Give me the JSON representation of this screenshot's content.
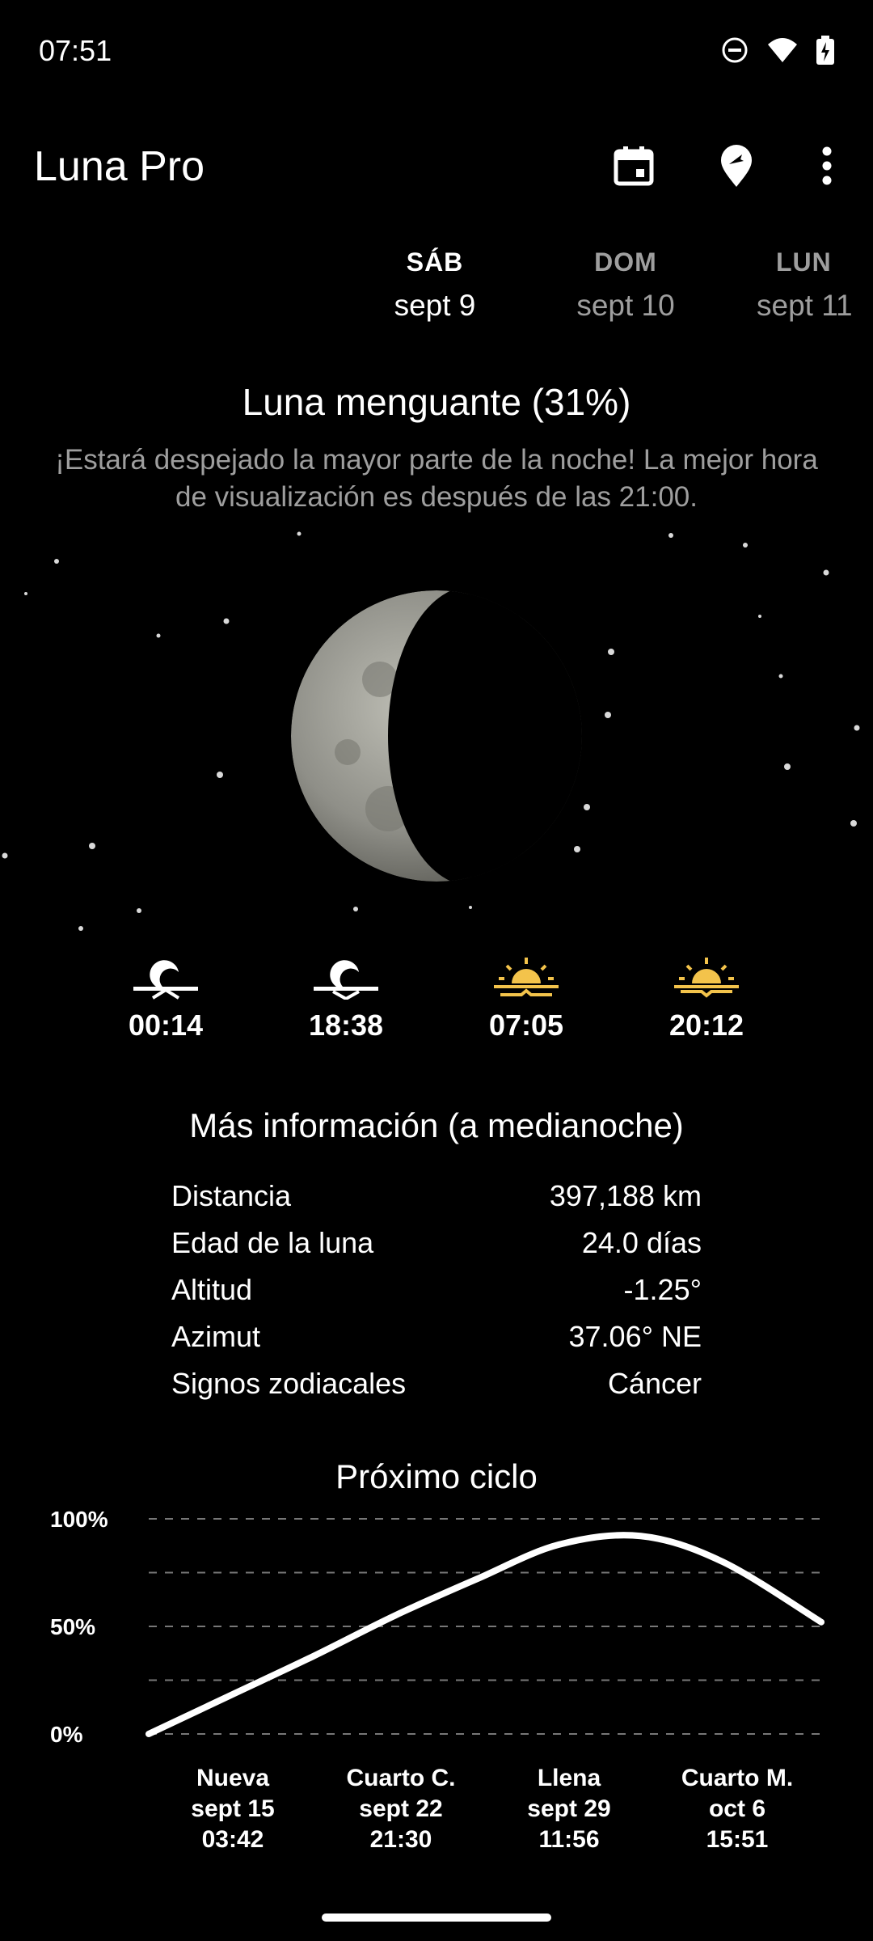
{
  "status_bar": {
    "time": "07:51",
    "icons": [
      "dnd-icon",
      "wifi-icon",
      "battery-charging-icon"
    ]
  },
  "app_bar": {
    "title": "Luna Pro",
    "actions": [
      "calendar-icon",
      "location-icon",
      "more-vert-icon"
    ]
  },
  "days": [
    {
      "dow": "SÁB",
      "date": "sept 9",
      "selected": true
    },
    {
      "dow": "DOM",
      "date": "sept 10",
      "selected": false
    },
    {
      "dow": "LUN",
      "date": "sept 11",
      "selected": false
    }
  ],
  "phase": {
    "title": "Luna menguante (31%)",
    "description": "¡Estará despejado la mayor parte de la noche! La mejor hora de visualización es después de las 21:00.",
    "illumination_percent": 31
  },
  "rise_set": [
    {
      "icon": "moonrise-icon",
      "time": "00:14"
    },
    {
      "icon": "moonset-icon",
      "time": "18:38"
    },
    {
      "icon": "sunrise-icon",
      "time": "07:05"
    },
    {
      "icon": "sunset-icon",
      "time": "20:12"
    }
  ],
  "info": {
    "title": "Más información (a medianoche)",
    "rows": [
      {
        "label": "Distancia",
        "value": "397,188 km"
      },
      {
        "label": "Edad de la luna",
        "value": "24.0 días"
      },
      {
        "label": "Altitud",
        "value": "-1.25°"
      },
      {
        "label": "Azimut",
        "value": "37.06° NE"
      },
      {
        "label": "Signos zodiacales",
        "value": "Cáncer"
      }
    ]
  },
  "cycle": {
    "title": "Próximo ciclo",
    "phases": [
      {
        "name": "Nueva",
        "date": "sept 15",
        "time": "03:42"
      },
      {
        "name": "Cuarto C.",
        "date": "sept 22",
        "time": "21:30"
      },
      {
        "name": "Llena",
        "date": "sept 29",
        "time": "11:56"
      },
      {
        "name": "Cuarto M.",
        "date": "oct 6",
        "time": "15:51"
      }
    ]
  },
  "chart_data": {
    "type": "line",
    "title": "Próximo ciclo",
    "y_tick_labels": [
      "100%",
      "50%",
      "0%"
    ],
    "ylim": [
      0,
      100
    ],
    "x_labels": [
      "Nueva",
      "Cuarto C.",
      "Llena",
      "Cuarto M."
    ],
    "series": [
      {
        "x": [
          0,
          0.5,
          1,
          1.5,
          2,
          2.5,
          3,
          3.5,
          4.1
        ],
        "values": [
          0,
          18,
          36,
          55,
          72,
          88,
          92,
          80,
          52
        ]
      }
    ],
    "grid": true,
    "colors": {
      "line": "#ffffff",
      "grid": "#777777"
    }
  },
  "colors": {
    "accent_sun": "#f3c34b",
    "muted_text": "#9e9e9e",
    "background": "#000000"
  }
}
